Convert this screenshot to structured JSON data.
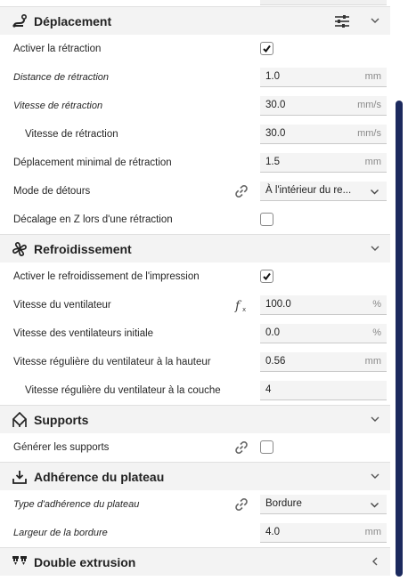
{
  "sections": {
    "travel": {
      "title": "Déplacement",
      "rows": {
        "enable_retraction": {
          "label": "Activer la rétraction",
          "checked": true
        },
        "retraction_distance": {
          "label": "Distance de rétraction",
          "value": "1.0",
          "unit": "mm"
        },
        "retraction_speed": {
          "label": "Vitesse de rétraction",
          "value": "30.0",
          "unit": "mm/s"
        },
        "retraction_speed_sub": {
          "label": "Vitesse de rétraction",
          "value": "30.0",
          "unit": "mm/s"
        },
        "min_travel": {
          "label": "Déplacement minimal de rétraction",
          "value": "1.5",
          "unit": "mm"
        },
        "combing_mode": {
          "label": "Mode de détours",
          "value": "À l'intérieur du re..."
        },
        "z_hop": {
          "label": "Décalage en Z lors d'une rétraction",
          "checked": false
        }
      }
    },
    "cooling": {
      "title": "Refroidissement",
      "rows": {
        "enable_cooling": {
          "label": "Activer le refroidissement de l'impression",
          "checked": true
        },
        "fan_speed": {
          "label": "Vitesse du ventilateur",
          "value": "100.0",
          "unit": "%"
        },
        "initial_fan_speed": {
          "label": "Vitesse des ventilateurs initiale",
          "value": "0.0",
          "unit": "%"
        },
        "regular_fan_height": {
          "label": "Vitesse régulière du ventilateur à la hauteur",
          "value": "0.56",
          "unit": "mm"
        },
        "regular_fan_layer": {
          "label": "Vitesse régulière du ventilateur à la couche",
          "value": "4"
        }
      }
    },
    "supports": {
      "title": "Supports",
      "rows": {
        "generate_supports": {
          "label": "Générer les supports",
          "checked": false
        }
      }
    },
    "adhesion": {
      "title": "Adhérence du plateau",
      "rows": {
        "adhesion_type": {
          "label": "Type d'adhérence du plateau",
          "value": "Bordure"
        },
        "brim_width": {
          "label": "Largeur de la bordure",
          "value": "4.0",
          "unit": "mm"
        }
      }
    },
    "dual": {
      "title": "Double extrusion"
    }
  },
  "icons": {
    "travel": "travel-icon",
    "settings": "settings-sliders-icon",
    "link": "link-icon",
    "formula": "fx-icon",
    "fan": "fan-icon",
    "support": "support-icon",
    "adhesion": "adhesion-icon",
    "dual": "dual-extrusion-icon",
    "chevron_down": "chevron-down-icon",
    "chevron_left": "chevron-left-icon"
  },
  "colors": {
    "accent": "#1c2a5e",
    "header_bg": "#f3f3f3",
    "field_bg": "#f4f4f4"
  }
}
